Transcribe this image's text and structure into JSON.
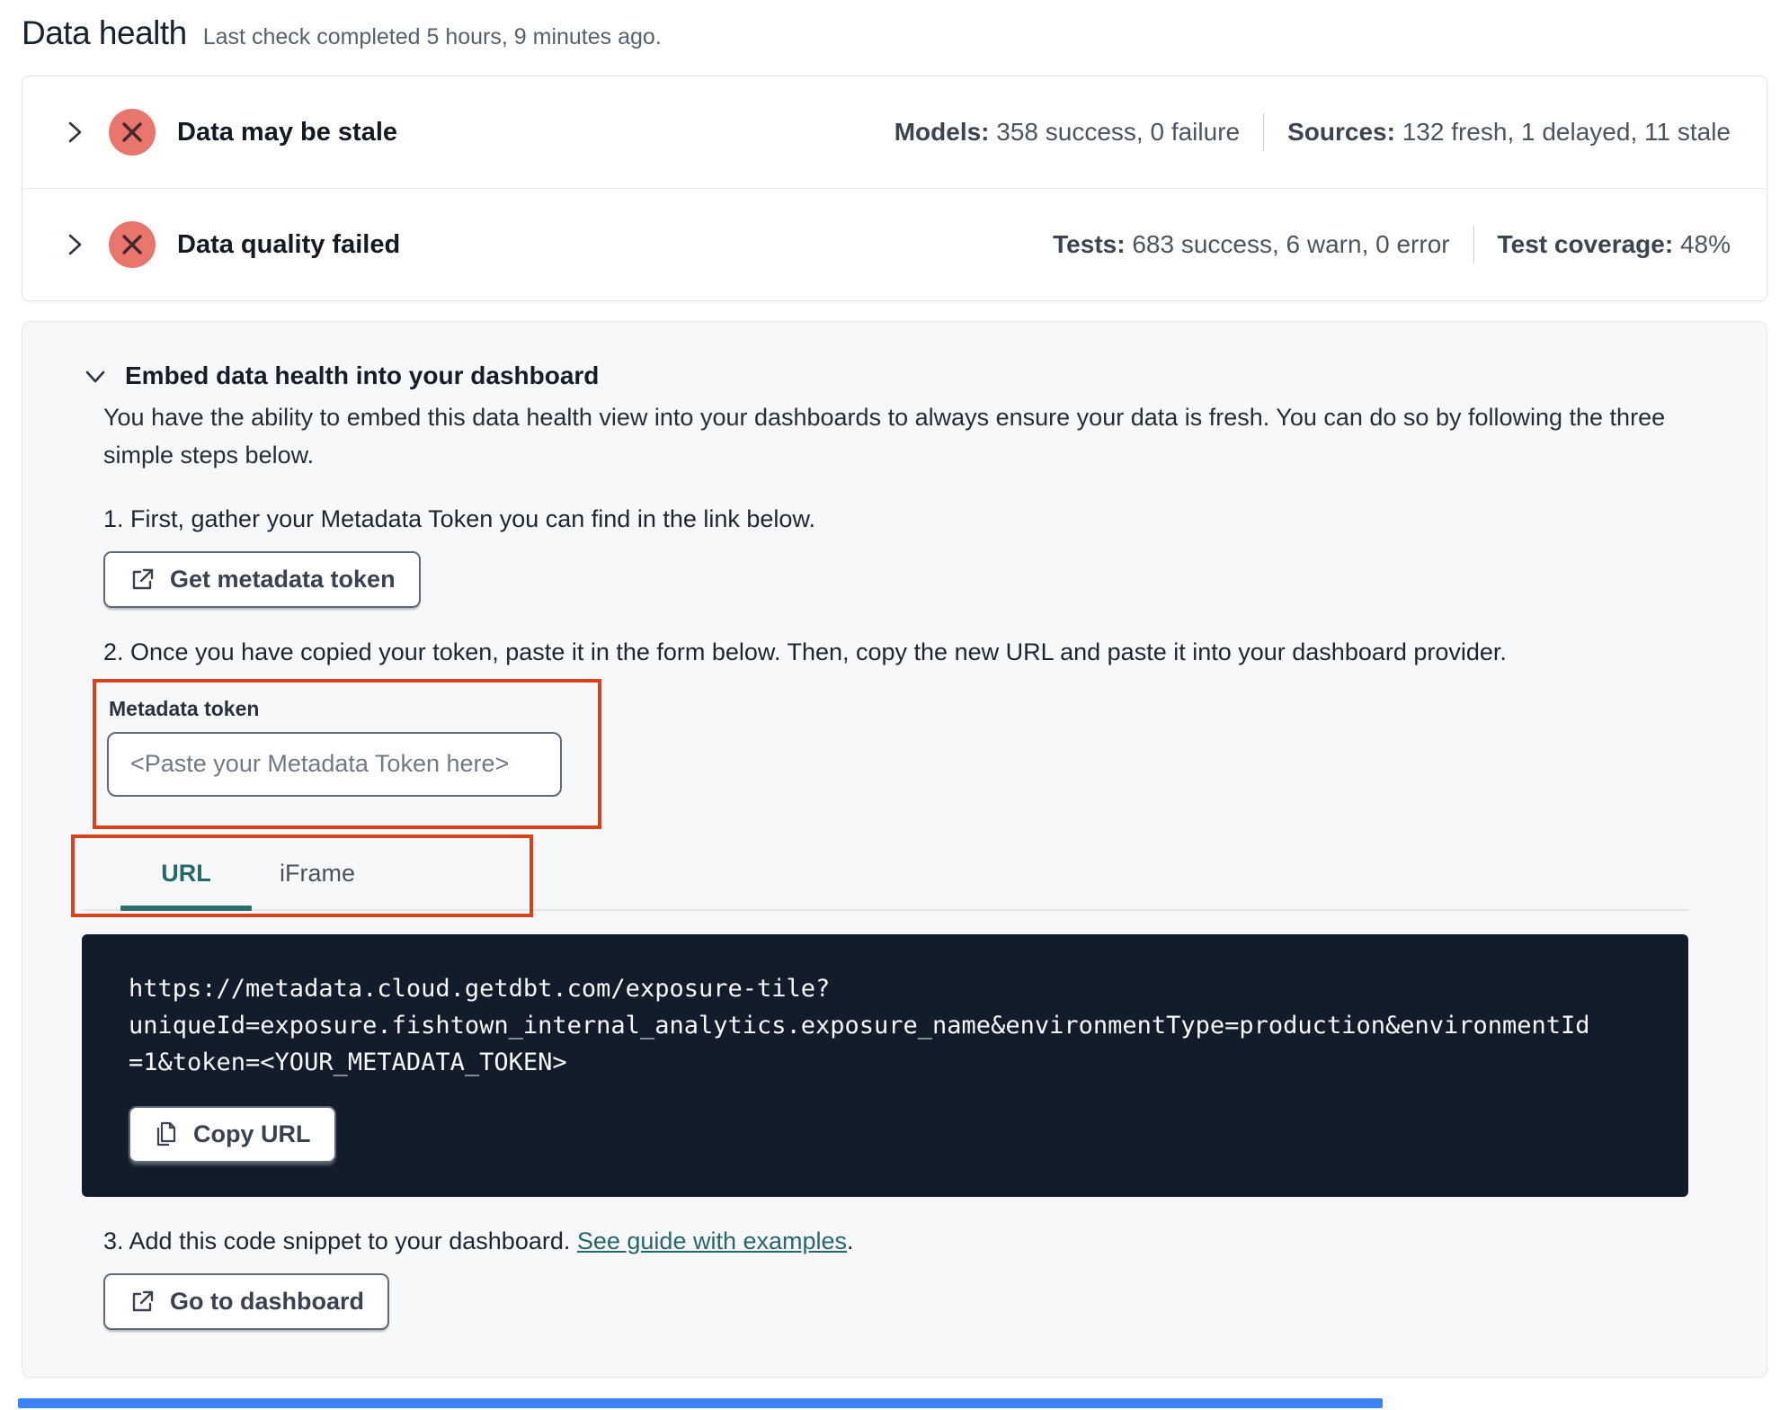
{
  "page": {
    "title": "Data health",
    "subtitle": "Last check completed 5 hours, 9 minutes ago."
  },
  "status_rows": [
    {
      "title": "Data may be stale",
      "stats": [
        {
          "label": "Models:",
          "value": "358 success, 0 failure"
        },
        {
          "label": "Sources:",
          "value": "132 fresh, 1 delayed, 11 stale"
        }
      ]
    },
    {
      "title": "Data quality failed",
      "stats": [
        {
          "label": "Tests:",
          "value": "683 success, 6 warn, 0 error"
        },
        {
          "label": "Test coverage:",
          "value": "48%"
        }
      ]
    }
  ],
  "embed": {
    "heading": "Embed data health into your dashboard",
    "description": "You have the ability to embed this data health view into your dashboards to always ensure your data is fresh. You can do so by following the three simple steps below.",
    "step1": "1. First, gather your Metadata Token you can find in the link below.",
    "get_token_button": "Get metadata token",
    "step2": "2. Once you have copied your token, paste it in the form below. Then, copy the new URL and paste it into your dashboard provider.",
    "token_field": {
      "label": "Metadata token",
      "value": "",
      "placeholder": "<Paste your Metadata Token here>"
    },
    "tabs": [
      {
        "label": "URL"
      },
      {
        "label": "iFrame"
      }
    ],
    "active_tab": "URL",
    "url": "https://metadata.cloud.getdbt.com/exposure-tile?uniqueId=exposure.fishtown_internal_analytics.exposure_name&environmentType=production&environmentId=1&token=<YOUR_METADATA_TOKEN>",
    "url_lines": [
      "https://metadata.cloud.getdbt.com/exposure-tile?",
      "uniqueId=exposure.fishtown_internal_analytics.exposure_name&environmentType=production&environmentId",
      "=1&token=<YOUR_METADATA_TOKEN>"
    ],
    "copy_button": "Copy URL",
    "step3_prefix": "3. Add this code snippet to your dashboard. ",
    "step3_link": "See guide with examples",
    "step3_suffix": ".",
    "dashboard_button": "Go to dashboard"
  },
  "colors": {
    "annotation_red": "#d8411c",
    "status_icon_bg": "#e8766d",
    "accent_teal": "#27666a",
    "code_background": "#121c2b",
    "bottom_bar_blue": "#3b82f6"
  },
  "icons": {
    "row_expander": "chevron-right",
    "status": "x-circle",
    "embed_expander": "chevron-down",
    "external_buttons": "external-link",
    "copy_button": "copy"
  }
}
